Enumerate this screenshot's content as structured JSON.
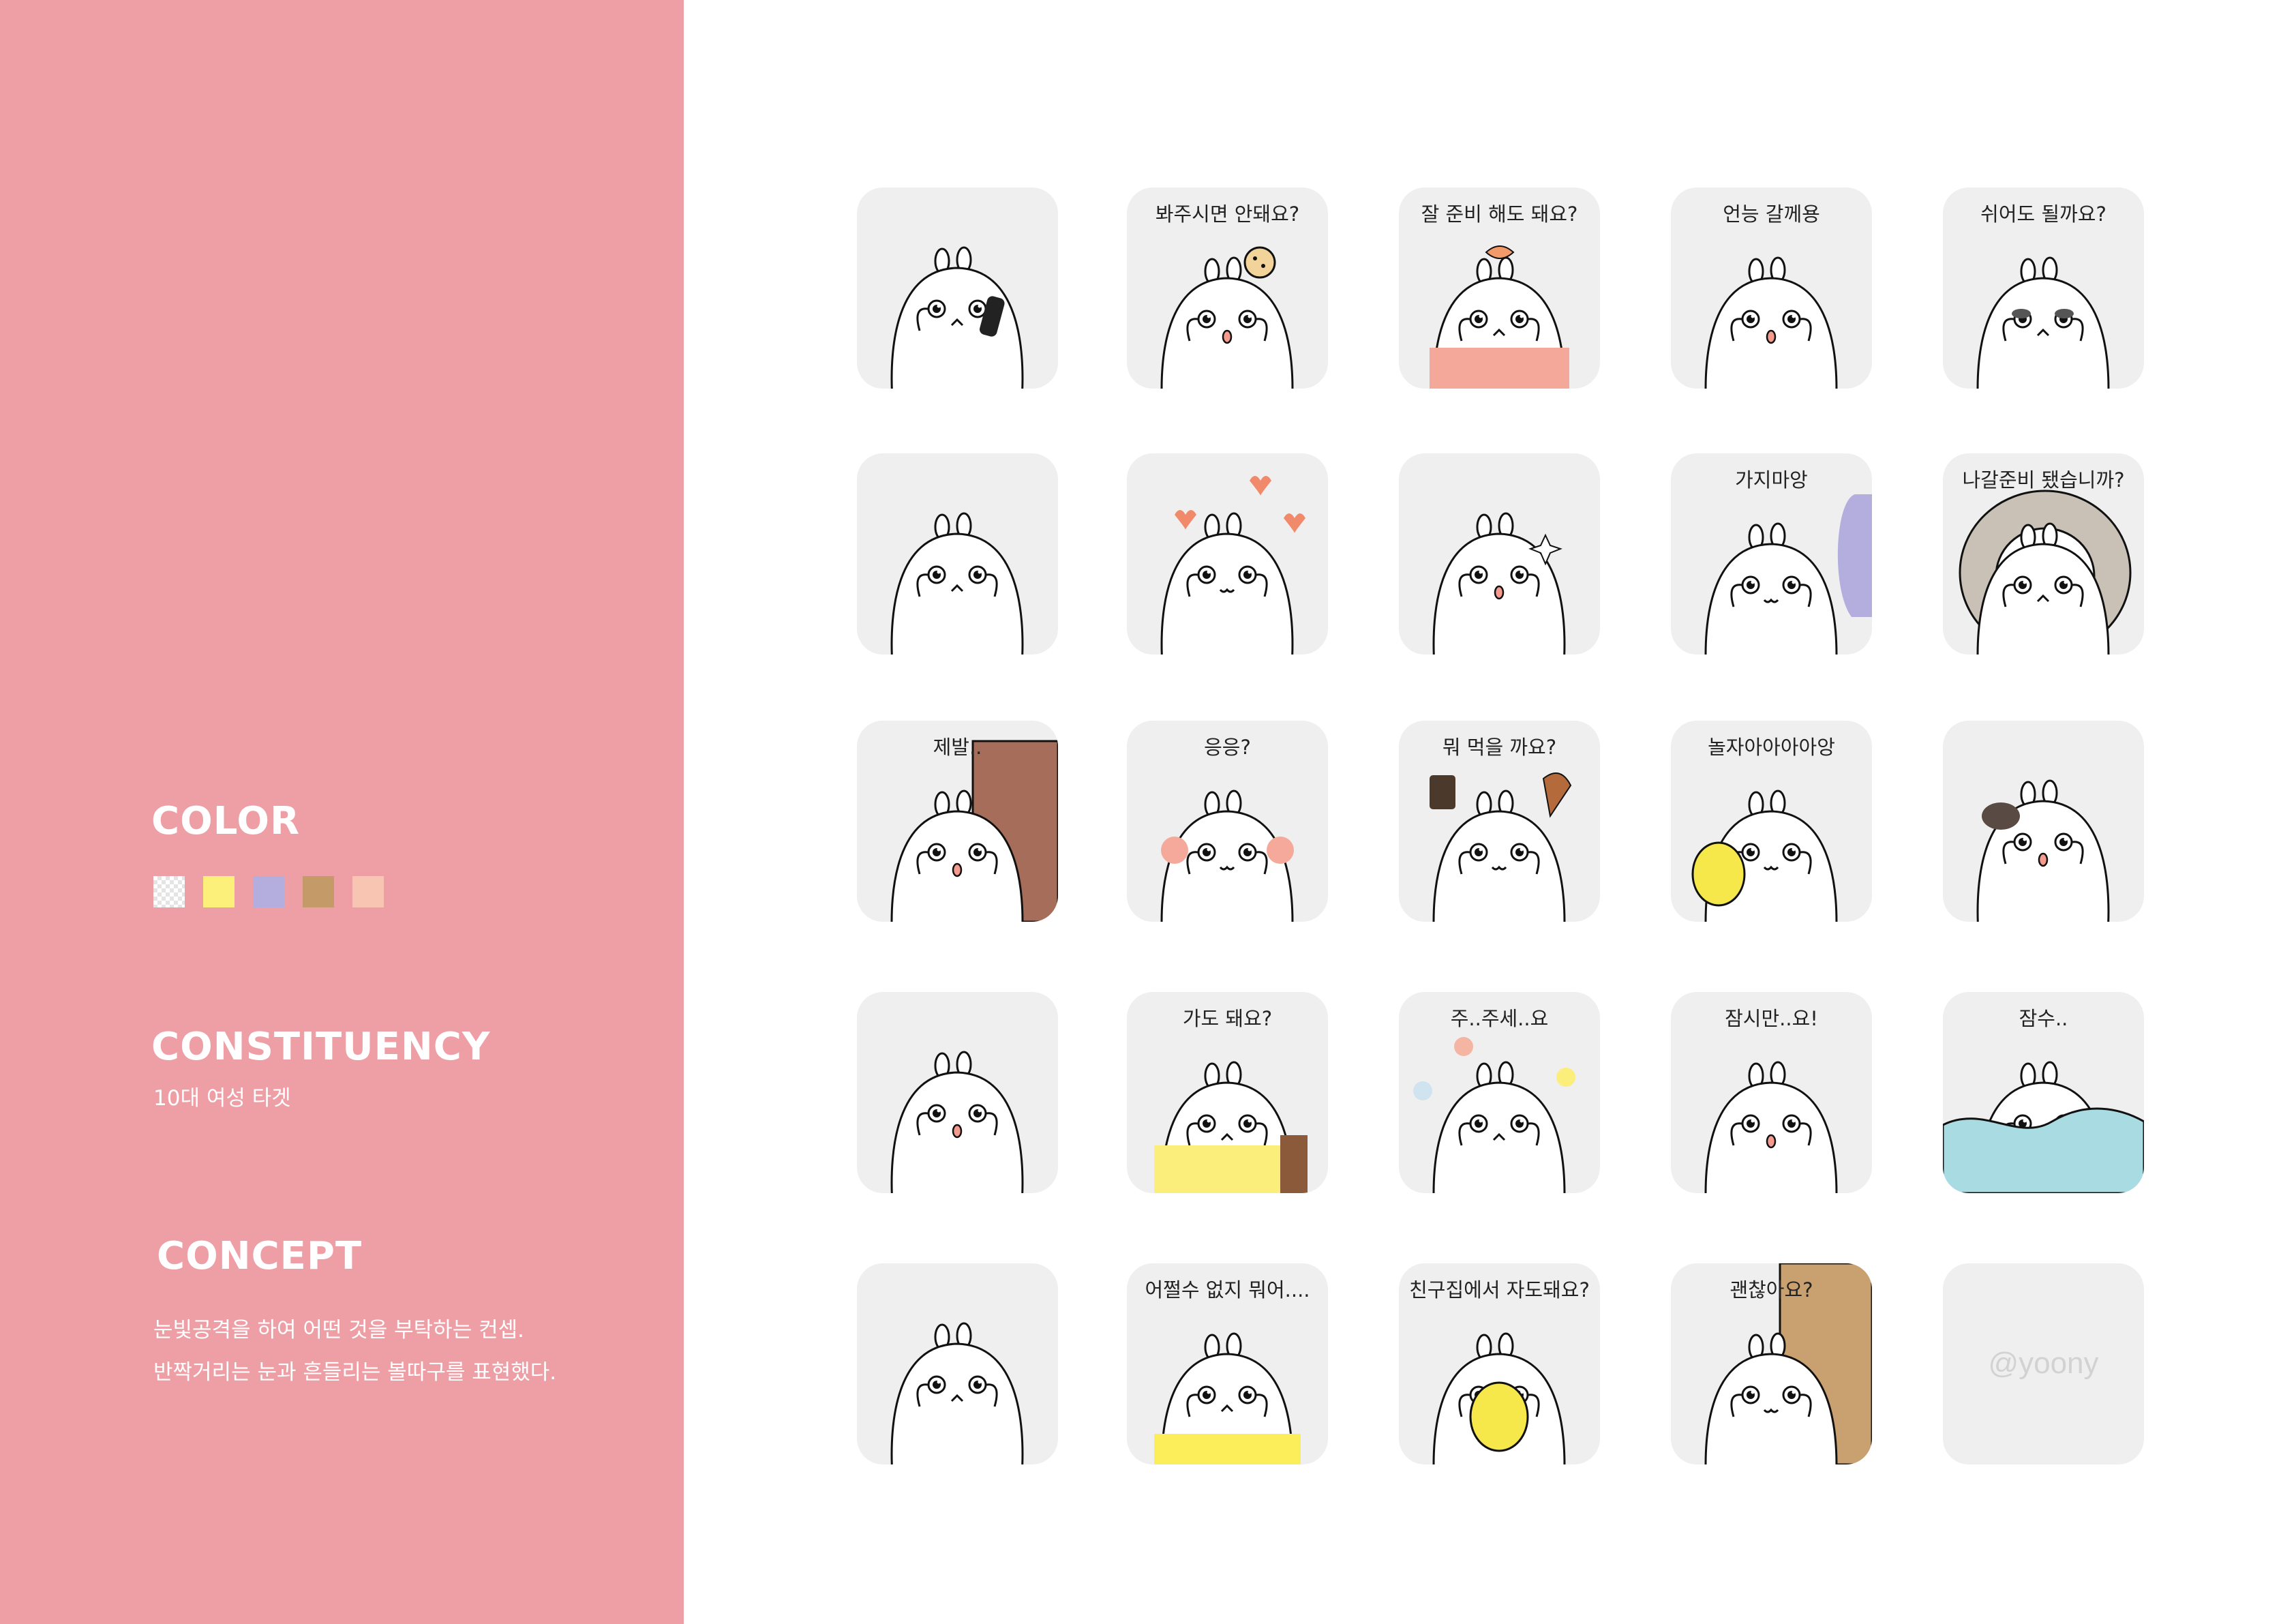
{
  "sidebar": {
    "color_title": "COLOR",
    "swatches": [
      {
        "name": "white",
        "hex": "#ffffff"
      },
      {
        "name": "yellow",
        "hex": "#fcf07a"
      },
      {
        "name": "lavender",
        "hex": "#b3aedd"
      },
      {
        "name": "tan",
        "hex": "#c49a68"
      },
      {
        "name": "peach",
        "hex": "#f7c5b1"
      }
    ],
    "constituency_title": "CONSTITUENCY",
    "constituency_text": "10대 여성 타겟",
    "concept_title": "CONCEPT",
    "concept_lines": [
      "눈빛공격을 하여 어떤 것을 부탁하는 컨셉.",
      "반짝거리는 눈과 흔들리는 볼따구를 표현했다."
    ]
  },
  "colors": {
    "sidebar_bg": "#ee9fa6",
    "tile_bg": "#efefef",
    "text_dark": "#222222"
  },
  "stickers": [
    {
      "caption": "",
      "pose": "phone"
    },
    {
      "caption": "봐주시면 안돼요?",
      "pose": "cookie"
    },
    {
      "caption": "잘 준비 해도 돼요?",
      "pose": "headband"
    },
    {
      "caption": "언능 갈께용",
      "pose": "wave"
    },
    {
      "caption": "쉬어도 될까요?",
      "pose": "tired"
    },
    {
      "caption": "",
      "pose": "blanket"
    },
    {
      "caption": "",
      "pose": "hearts"
    },
    {
      "caption": "",
      "pose": "sparkle"
    },
    {
      "caption": "가지마앙",
      "pose": "hug-leg"
    },
    {
      "caption": "나갈준비 됐습니까?",
      "pose": "hood"
    },
    {
      "caption": "제발..",
      "pose": "door"
    },
    {
      "caption": "응응?",
      "pose": "blush"
    },
    {
      "caption": "뭐 먹을 까요?",
      "pose": "food"
    },
    {
      "caption": "놀자아아아아앙",
      "pose": "chick-kiss"
    },
    {
      "caption": "",
      "pose": "rock"
    },
    {
      "caption": "",
      "pose": "cry"
    },
    {
      "caption": "가도 돼요?",
      "pose": "backpack"
    },
    {
      "caption": "주..주세..요",
      "pose": "flowers"
    },
    {
      "caption": "잠시만..요!",
      "pose": "think"
    },
    {
      "caption": "잠수..",
      "pose": "water"
    },
    {
      "caption": "",
      "pose": "sit"
    },
    {
      "caption": "어쩔수 없지 뭐어....",
      "pose": "gloom"
    },
    {
      "caption": "친구집에서 자도돼요?",
      "pose": "chick-hold"
    },
    {
      "caption": "괜찮아요?",
      "pose": "peek"
    },
    {
      "caption": "",
      "pose": "watermark",
      "watermark": "@yoony"
    }
  ]
}
